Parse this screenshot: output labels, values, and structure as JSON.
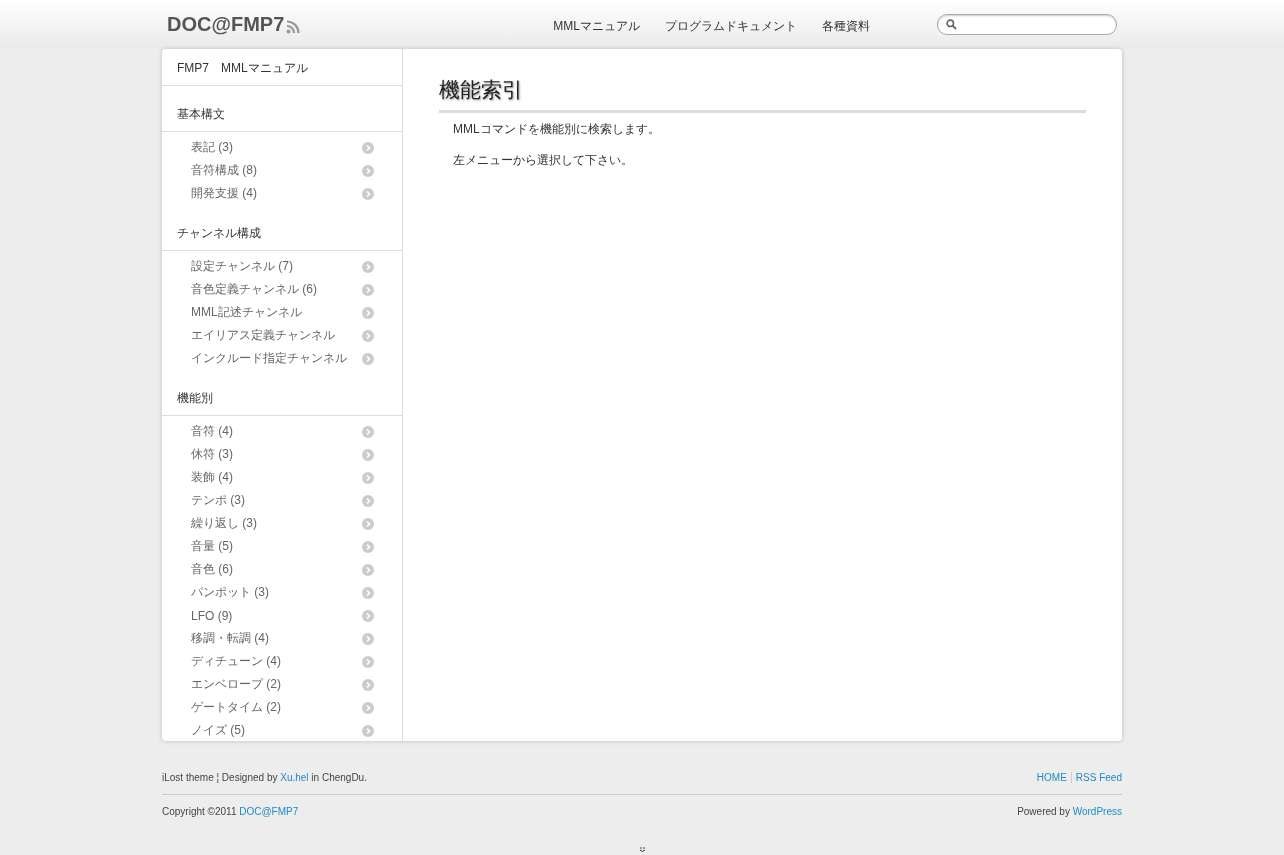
{
  "header": {
    "site_title": "DOC@FMP7",
    "nav": [
      {
        "label": "MMLマニュアル"
      },
      {
        "label": "プログラムドキュメント"
      },
      {
        "label": "各種資料"
      }
    ]
  },
  "sidebar": {
    "title": "FMP7　MMLマニュアル",
    "sections": [
      {
        "heading": "基本構文",
        "items": [
          "表記 (3)",
          "音符構成 (8)",
          "開発支援 (4)"
        ]
      },
      {
        "heading": "チャンネル構成",
        "items": [
          "設定チャンネル (7)",
          "音色定義チャンネル (6)",
          "MML記述チャンネル",
          "エイリアス定義チャンネル",
          "インクルード指定チャンネル"
        ]
      },
      {
        "heading": "機能別",
        "items": [
          "音符 (4)",
          "休符 (3)",
          "装飾 (4)",
          "テンポ (3)",
          "繰り返し (3)",
          "音量 (5)",
          "音色 (6)",
          "パンポット (3)",
          "LFO (9)",
          "移調・転調 (4)",
          "ディチューン (4)",
          "エンベロープ (2)",
          "ゲートタイム (2)",
          "ノイズ (5)"
        ]
      }
    ]
  },
  "main": {
    "title": "機能索引",
    "paragraphs": [
      "MMLコマンドを機能別に検索します。",
      "左メニューから選択して下さい。"
    ]
  },
  "footer": {
    "credit": {
      "before": "iLost theme ¦ Designed by ",
      "link": "Xu.hel",
      "after": " in ChengDu."
    },
    "links": [
      "HOME",
      "RSS Feed"
    ],
    "copyright": {
      "before": "Copyright ©2011 ",
      "link": "DOC@FMP7"
    },
    "powered": {
      "before": "Powered by ",
      "link": "WordPress"
    }
  }
}
